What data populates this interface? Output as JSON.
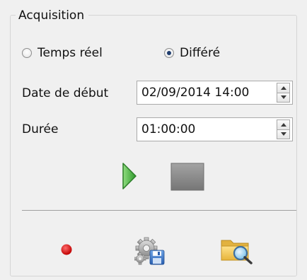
{
  "group": {
    "title": "Acquisition"
  },
  "mode": {
    "realtime_label": "Temps réel",
    "deferred_label": "Différé",
    "selected": "deferred"
  },
  "start_date": {
    "label": "Date de début",
    "value": "02/09/2014 14:00"
  },
  "duration": {
    "label": "Durée",
    "value": "01:00:00"
  },
  "icons": {
    "play": "play-icon",
    "stop": "stop-icon",
    "record": "record-icon",
    "settings": "gear-save-icon",
    "open_folder": "folder-search-icon"
  },
  "colors": {
    "play_green": "#3fa63a",
    "stop_gray": "#8a8a8a",
    "record_red": "#d60000",
    "folder_yellow": "#f2c94c"
  }
}
